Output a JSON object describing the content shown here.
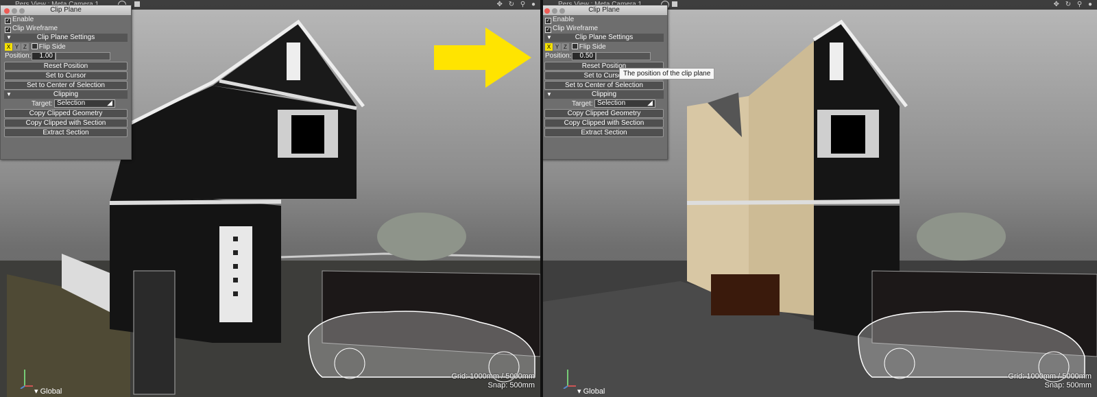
{
  "viewports": [
    {
      "title": "Pers View : Meta Camera 1",
      "panel": {
        "title": "Clip Plane",
        "enable_label": "Enable",
        "clip_wireframe_label": "Clip Wireframe",
        "settings_label": "Clip Plane Settings",
        "axes": [
          "X",
          "Y",
          "Z"
        ],
        "active_axis": "X",
        "flip_side_label": "Flip Side",
        "position_label": "Position:",
        "position_value": "1.00",
        "buttons": [
          "Reset Position",
          "Set to Cursor",
          "Set to Center of Selection"
        ],
        "clipping_label": "Clipping",
        "target_label": "Target:",
        "target_value": "Selection",
        "clip_buttons": [
          "Copy Clipped Geometry",
          "Copy Clipped with Section",
          "Extract Section"
        ]
      },
      "grid_text": "Grid: 1000mm / 5000mm",
      "snap_text": "Snap: 500mm",
      "global_label": "Global"
    },
    {
      "title": "Pers View : Meta Camera 1",
      "panel": {
        "title": "Clip Plane",
        "enable_label": "Enable",
        "clip_wireframe_label": "Clip Wireframe",
        "settings_label": "Clip Plane Settings",
        "axes": [
          "X",
          "Y",
          "Z"
        ],
        "active_axis": "X",
        "flip_side_label": "Flip Side",
        "position_label": "Position:",
        "position_value": "0.50",
        "buttons": [
          "Reset Position",
          "Set to Cursor",
          "Set to Center of Selection"
        ],
        "clipping_label": "Clipping",
        "target_label": "Target:",
        "target_value": "Selection",
        "clip_buttons": [
          "Copy Clipped Geometry",
          "Copy Clipped with Section",
          "Extract Section"
        ]
      },
      "tooltip": "The position of the clip plane",
      "grid_text": "Grid: 1000mm / 5000mm",
      "snap_text": "Snap: 500mm",
      "global_label": "Global"
    }
  ],
  "colors": {
    "arrow": "#ffe400",
    "active_axis": "#f5e100",
    "section_fill": "#d8c7a4",
    "house": "#141414"
  }
}
